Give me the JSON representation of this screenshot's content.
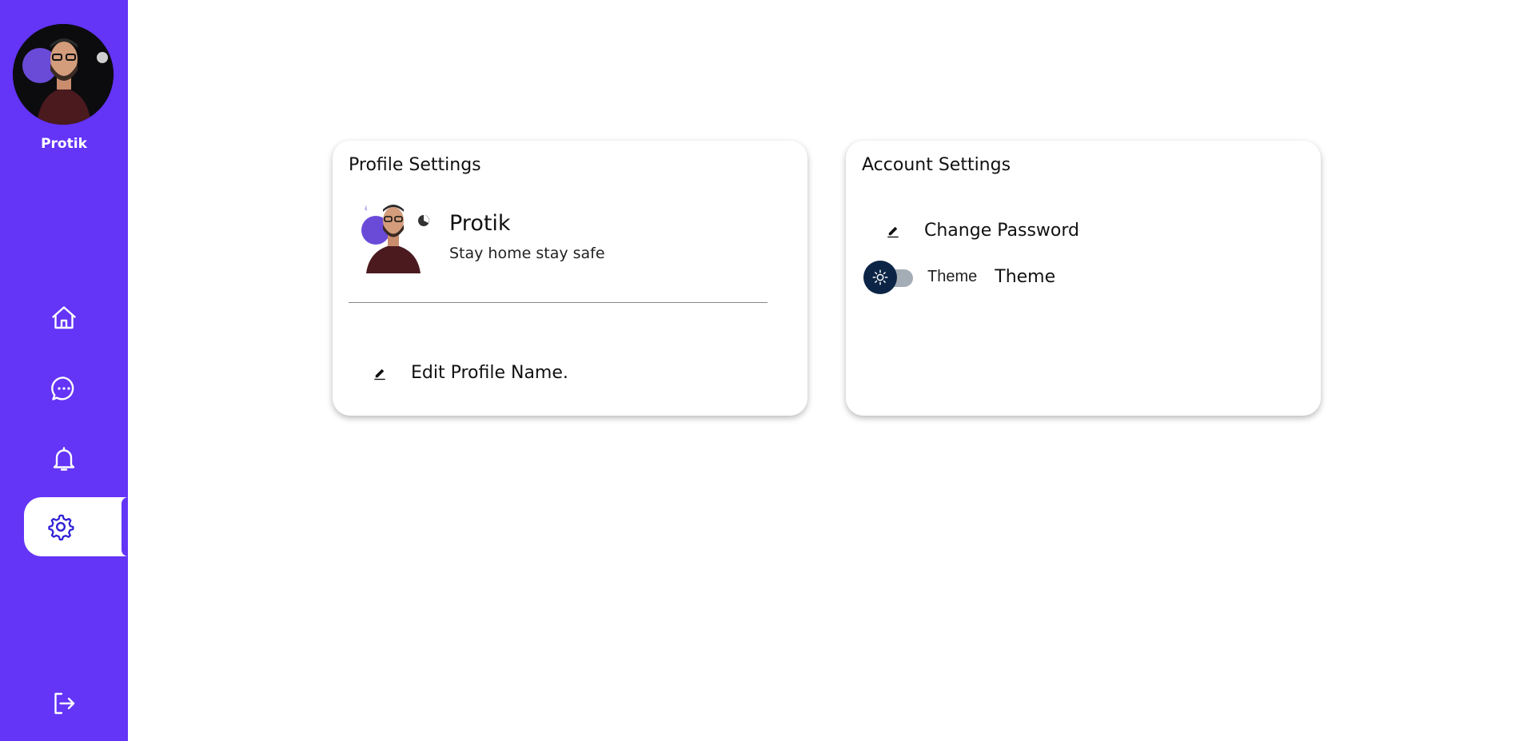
{
  "sidebar": {
    "user_name": "Protik",
    "nav": [
      {
        "icon": "home-icon"
      },
      {
        "icon": "chat-icon"
      },
      {
        "icon": "bell-icon"
      },
      {
        "icon": "gear-icon",
        "active": true
      }
    ],
    "logout_icon": "logout-icon"
  },
  "profile_card": {
    "title": "Profile Settings",
    "name": "Protik",
    "status": "Stay home stay safe",
    "edit_label": "Edit Profile Name."
  },
  "account_card": {
    "title": "Account Settings",
    "change_password_label": "Change Password",
    "theme_toggle_label": "Theme",
    "theme_label": "Theme"
  },
  "colors": {
    "sidebar": "#6434f7",
    "active_icon": "#2f1fd6",
    "toggle_knob": "#0c2546"
  }
}
